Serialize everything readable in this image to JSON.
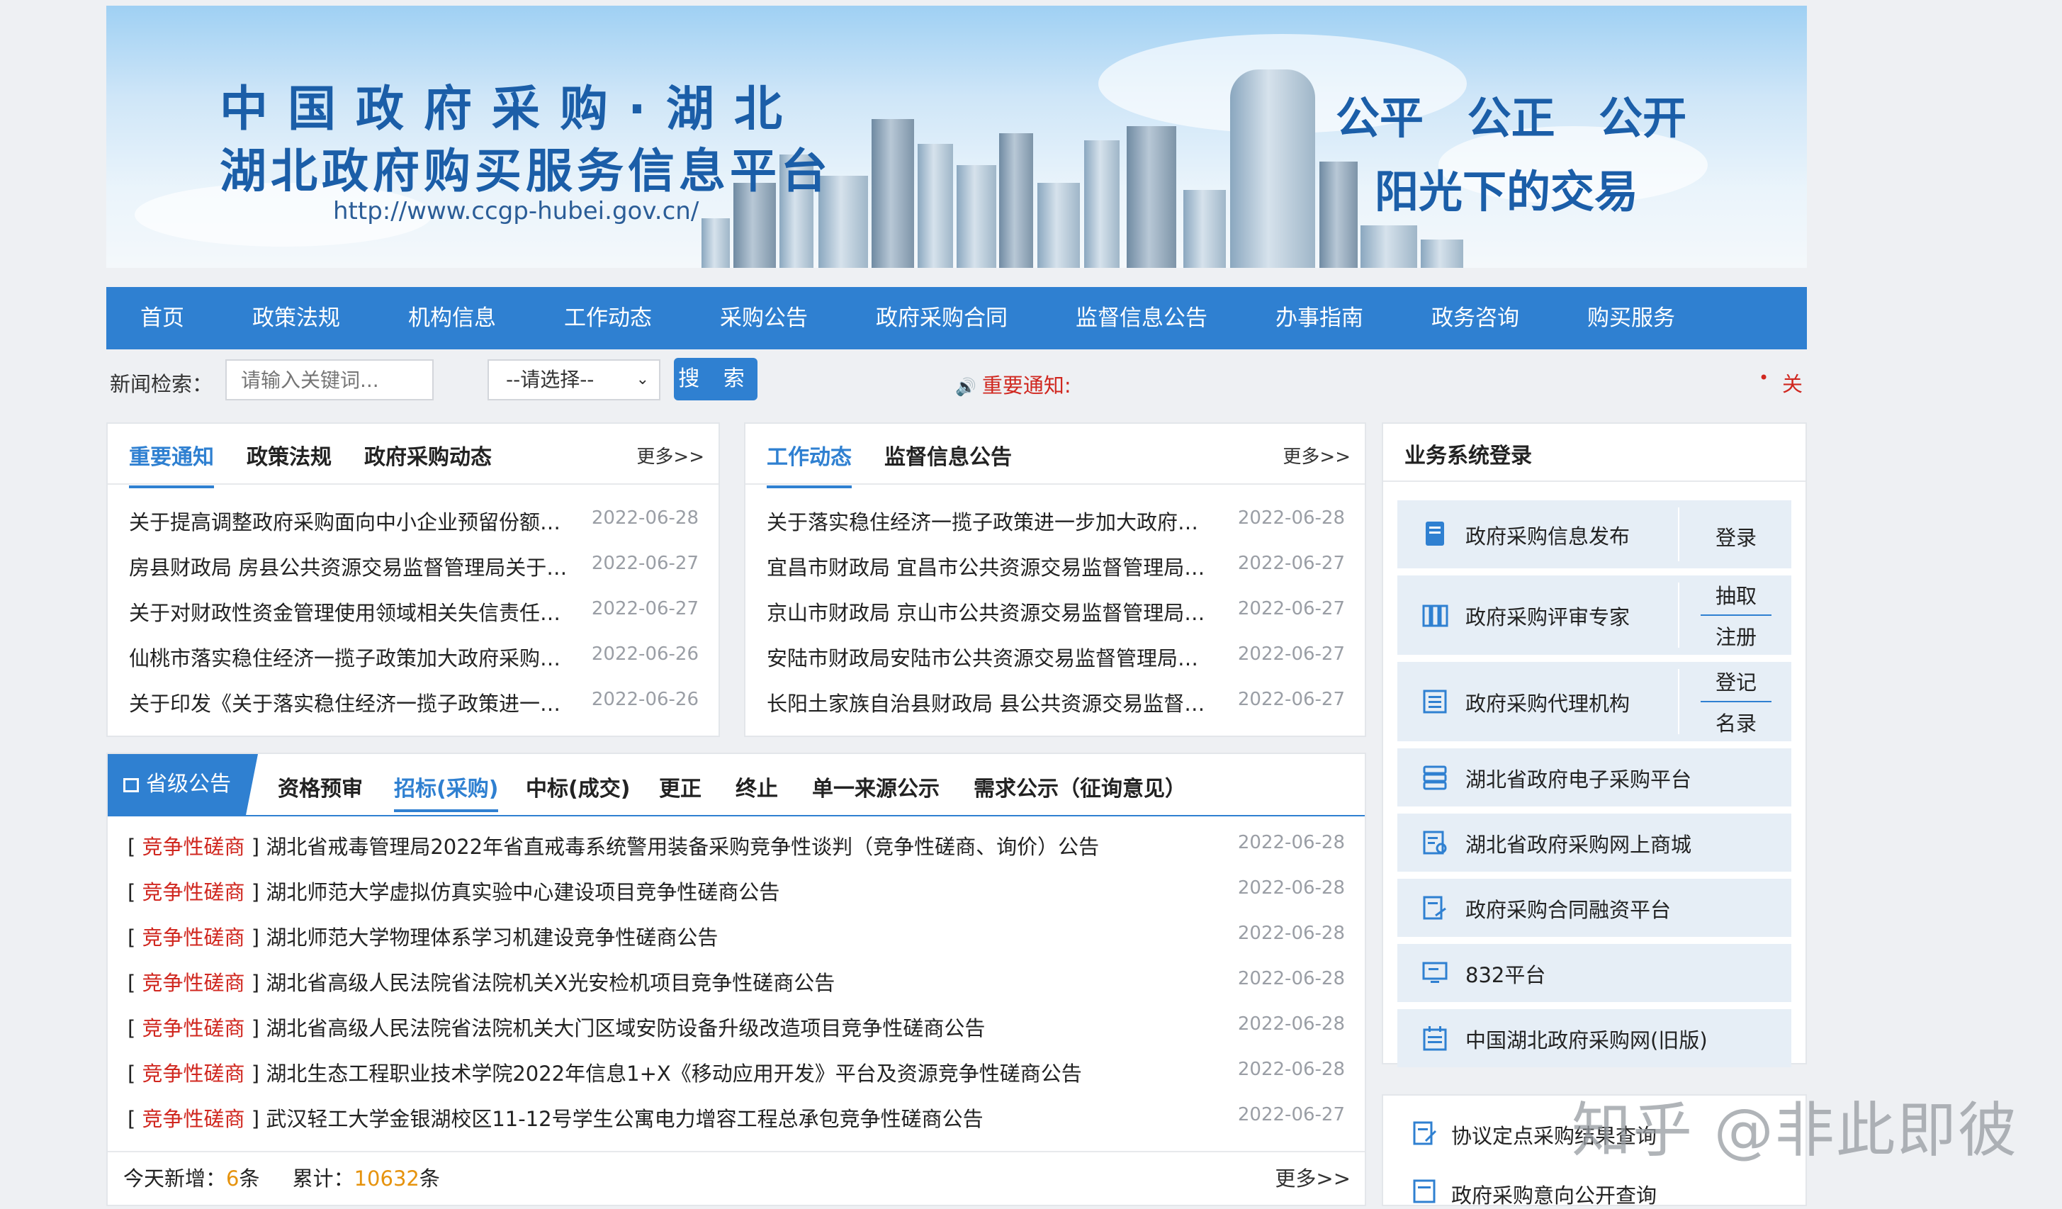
{
  "banner": {
    "title_line1": "中国政府采购·湖北",
    "title_line2": "湖北政府购买服务信息平台",
    "url": "http://www.ccgp-hubei.gov.cn/",
    "slogan1": "公平 公正 公开",
    "slogan2": "阳光下的交易"
  },
  "nav": [
    "首页",
    "政策法规",
    "机构信息",
    "工作动态",
    "采购公告",
    "政府采购合同",
    "监督信息公告",
    "办事指南",
    "政务咨询",
    "购买服务"
  ],
  "search": {
    "label": "新闻检索：",
    "placeholder": "请输入关键词...",
    "select_value": "--请选择--",
    "button": "搜 索",
    "notice_label": "重要通知:",
    "ticker_fragment": "关"
  },
  "panel_left": {
    "tabs": [
      "重要通知",
      "政策法规",
      "政府采购动态"
    ],
    "more": "更多>>",
    "items": [
      {
        "title": "关于提高调整政府采购面向中小企业预留份额…",
        "date": "2022-06-28"
      },
      {
        "title": "房县财政局 房县公共资源交易监督管理局关于…",
        "date": "2022-06-27"
      },
      {
        "title": "关于对财政性资金管理使用领域相关失信责任…",
        "date": "2022-06-27"
      },
      {
        "title": "仙桃市落实稳住经济一揽子政策加大政府采购…",
        "date": "2022-06-26"
      },
      {
        "title": "关于印发《关于落实稳住经济一揽子政策进一…",
        "date": "2022-06-26"
      }
    ]
  },
  "panel_mid": {
    "tabs": [
      "工作动态",
      "监督信息公告"
    ],
    "more": "更多>>",
    "items": [
      {
        "title": "关于落实稳住经济一揽子政策进一步加大政府…",
        "date": "2022-06-28"
      },
      {
        "title": "宜昌市财政局 宜昌市公共资源交易监督管理局…",
        "date": "2022-06-27"
      },
      {
        "title": "京山市财政局 京山市公共资源交易监督管理局…",
        "date": "2022-06-27"
      },
      {
        "title": "安陆市财政局安陆市公共资源交易监督管理局…",
        "date": "2022-06-27"
      },
      {
        "title": "长阳土家族自治县财政局 县公共资源交易监督…",
        "date": "2022-06-27"
      }
    ]
  },
  "bulletin": {
    "main_tab": "省级公告",
    "tabs": [
      "资格预审",
      "招标(采购)",
      "中标(成交)",
      "更正",
      "终止",
      "单一来源公示",
      "需求公示（征询意见）"
    ],
    "category": "竞争性磋商",
    "items": [
      {
        "title": "湖北省戒毒管理局2022年省直戒毒系统警用装备采购竞争性谈判（竞争性磋商、询价）公告",
        "date": "2022-06-28"
      },
      {
        "title": "湖北师范大学虚拟仿真实验中心建设项目竞争性磋商公告",
        "date": "2022-06-28"
      },
      {
        "title": "湖北师范大学物理体系学习机建设竞争性磋商公告",
        "date": "2022-06-28"
      },
      {
        "title": "湖北省高级人民法院省法院机关X光安检机项目竞争性磋商公告",
        "date": "2022-06-28"
      },
      {
        "title": "湖北省高级人民法院省法院机关大门区域安防设备升级改造项目竞争性磋商公告",
        "date": "2022-06-28"
      },
      {
        "title": "湖北生态工程职业技术学院2022年信息1+X《移动应用开发》平台及资源竞争性磋商公告",
        "date": "2022-06-28"
      },
      {
        "title": "武汉轻工大学金银湖校区11-12号学生公寓电力增容工程总承包竞争性磋商公告",
        "date": "2022-06-27"
      }
    ],
    "footer": {
      "today_label": "今天新增：",
      "today_count": "6",
      "today_unit": "条",
      "total_label": "累计：",
      "total_count": "10632",
      "total_unit": "条",
      "more": "更多>>"
    }
  },
  "login": {
    "title": "业务系统登录",
    "systems": [
      {
        "name": "政府采购信息发布",
        "icon": "document-icon",
        "actions": [
          "登录"
        ]
      },
      {
        "name": "政府采购评审专家",
        "icon": "expert-icon",
        "actions": [
          "抽取",
          "注册"
        ]
      },
      {
        "name": "政府采购代理机构",
        "icon": "list-icon",
        "actions": [
          "登记",
          "名录"
        ]
      },
      {
        "name": "湖北省政府电子采购平台",
        "icon": "server-icon",
        "actions": []
      },
      {
        "name": "湖北省政府采购网上商城",
        "icon": "shop-icon",
        "actions": []
      },
      {
        "name": "政府采购合同融资平台",
        "icon": "contract-icon",
        "actions": []
      },
      {
        "name": "832平台",
        "icon": "monitor-icon",
        "actions": []
      },
      {
        "name": "中国湖北政府采购网(旧版)",
        "icon": "calendar-icon",
        "actions": []
      }
    ],
    "extra_item": "协议定点采购结果查询",
    "extra_item2": "政府采购意向公开查询"
  },
  "watermark": "知乎 @非此即彼"
}
